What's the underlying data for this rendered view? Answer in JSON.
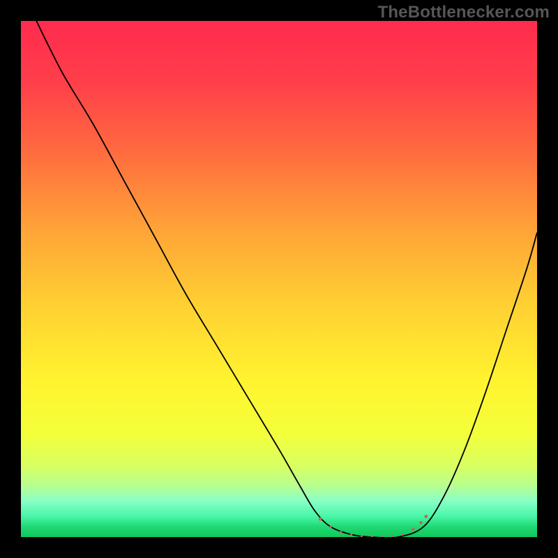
{
  "watermark": {
    "text": "TheBottlenecker.com"
  },
  "colors": {
    "frame": "#000000",
    "curve_stroke": "#000000",
    "marker_fill": "#cd5d57",
    "gradient_stops": [
      {
        "pct": 0,
        "color": "#ff2b4e"
      },
      {
        "pct": 12,
        "color": "#ff3f4a"
      },
      {
        "pct": 25,
        "color": "#ff6a3f"
      },
      {
        "pct": 40,
        "color": "#ffa238"
      },
      {
        "pct": 55,
        "color": "#ffd032"
      },
      {
        "pct": 70,
        "color": "#fff42f"
      },
      {
        "pct": 80,
        "color": "#f3ff3a"
      },
      {
        "pct": 86,
        "color": "#d9ff60"
      },
      {
        "pct": 90,
        "color": "#b8ff8f"
      },
      {
        "pct": 93,
        "color": "#89ffc6"
      },
      {
        "pct": 96,
        "color": "#48f6a8"
      },
      {
        "pct": 98,
        "color": "#1fd973"
      },
      {
        "pct": 100,
        "color": "#12c75e"
      }
    ]
  },
  "chart_data": {
    "type": "line",
    "title": "",
    "xlabel": "",
    "ylabel": "",
    "xlim": [
      0,
      100
    ],
    "ylim": [
      0,
      100
    ],
    "grid": false,
    "legend": false,
    "series": [
      {
        "name": "bottleneck-curve",
        "x": [
          3,
          8,
          14,
          20,
          26,
          32,
          38,
          44,
          50,
          54,
          57,
          60,
          64,
          68,
          73,
          78,
          82,
          86,
          90,
          94,
          98,
          100
        ],
        "y": [
          100,
          90,
          80,
          69,
          58,
          47,
          37,
          27,
          17,
          10,
          5,
          2,
          0.5,
          0,
          0,
          2,
          8,
          17,
          28,
          40,
          52,
          59
        ]
      }
    ],
    "markers": {
      "name": "flat-bottom-markers",
      "color": "#cd5d57",
      "points": [
        {
          "x": 58,
          "y": 3.5,
          "r": 2.4
        },
        {
          "x": 60,
          "y": 2.0,
          "r": 1.6
        },
        {
          "x": 62,
          "y": 1.0,
          "r": 1.6
        },
        {
          "x": 64,
          "y": 0.5,
          "r": 1.6
        },
        {
          "x": 66,
          "y": 0.2,
          "r": 1.6
        },
        {
          "x": 68,
          "y": 0.0,
          "r": 1.6
        },
        {
          "x": 70,
          "y": 0.0,
          "r": 1.6
        },
        {
          "x": 72,
          "y": 0.1,
          "r": 1.6
        },
        {
          "x": 74,
          "y": 0.5,
          "r": 1.8
        },
        {
          "x": 76,
          "y": 1.5,
          "r": 2.0
        },
        {
          "x": 77.5,
          "y": 2.8,
          "r": 2.2
        },
        {
          "x": 78.5,
          "y": 4.0,
          "r": 2.4
        }
      ]
    }
  }
}
